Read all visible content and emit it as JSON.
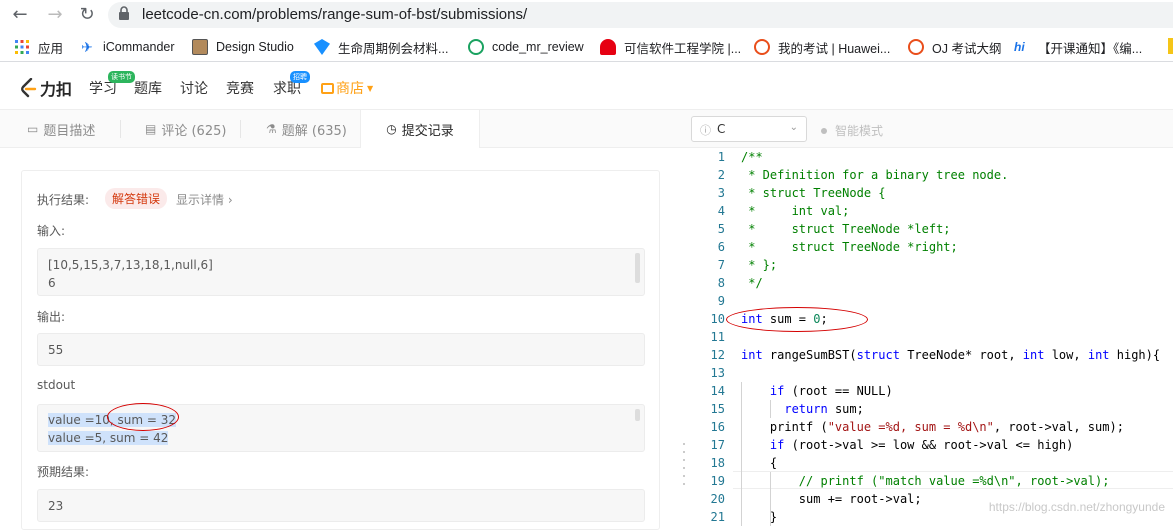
{
  "browser": {
    "url": "leetcode-cn.com/problems/range-sum-of-bst/submissions/",
    "bookmarks": [
      {
        "label": "应用",
        "icon": "apps-grid-icon"
      },
      {
        "label": "iCommander",
        "icon": "icommander-icon"
      },
      {
        "label": "Design Studio",
        "icon": "design-studio-icon"
      },
      {
        "label": "生命周期例会材料...",
        "icon": "bookmark-icon"
      },
      {
        "label": "code_mr_review",
        "icon": "code-review-icon"
      },
      {
        "label": "可信软件工程学院 |...",
        "icon": "huawei-icon"
      },
      {
        "label": "我的考试 | Huawei...",
        "icon": "exam-icon"
      },
      {
        "label": "OJ 考试大纲",
        "icon": "exam-icon"
      },
      {
        "label": "【开课通知】《编...",
        "icon": "course-icon"
      }
    ]
  },
  "site": {
    "logo": "力扣",
    "nav": [
      {
        "label": "学习",
        "badge": "读书节"
      },
      {
        "label": "题库",
        "badge": ""
      },
      {
        "label": "讨论",
        "badge": ""
      },
      {
        "label": "竞赛",
        "badge": ""
      },
      {
        "label": "求职",
        "badge": "招聘"
      },
      {
        "label": "商店",
        "badge": ""
      }
    ]
  },
  "tabs": [
    {
      "label": "题目描述",
      "icon": "description-icon"
    },
    {
      "label": "评论 (625)",
      "icon": "comment-icon"
    },
    {
      "label": "题解 (635)",
      "icon": "flask-icon"
    },
    {
      "label": "提交记录",
      "icon": "clock-icon"
    }
  ],
  "result": {
    "exec_label": "执行结果:",
    "status": "解答错误",
    "detail": "显示详情 ›",
    "input_label": "输入:",
    "input_line1": "[10,5,15,3,7,13,18,1,null,6]",
    "input_line2": "6",
    "output_label": "输出:",
    "output_value": "55",
    "stdout_label": "stdout",
    "stdout_line1": "value =10, sum = 32",
    "stdout_line2": "value =5, sum = 42",
    "expected_label": "预期结果:",
    "expected_value": "23"
  },
  "editor": {
    "language": "C",
    "mode": "智能模式",
    "lines": [
      "1",
      "2",
      "3",
      "4",
      "5",
      "6",
      "7",
      "8",
      "9",
      "10",
      "11",
      "12",
      "13",
      "14",
      "15",
      "16",
      "17",
      "18",
      "19",
      "20",
      "21"
    ]
  },
  "watermark": "https://blog.csdn.net/zhongyunde",
  "colors": {
    "accent": "#d40000",
    "status_error": "#d4380d",
    "store": "#ffa116"
  }
}
